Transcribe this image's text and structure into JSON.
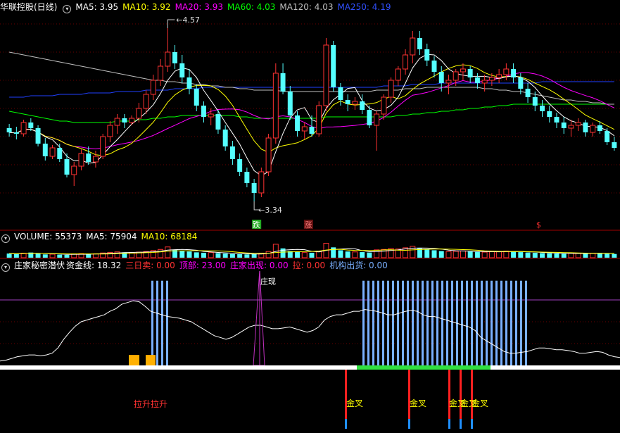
{
  "main_header": {
    "title": "华联控股(日线)",
    "ma5": "MA5: 3.95",
    "ma10": "MA10: 3.92",
    "ma20": "MA20: 3.93",
    "ma60": "MA60: 4.03",
    "ma120": "MA120: 4.03",
    "ma250": "MA250: 4.19"
  },
  "volume_header": {
    "label": "VOLUME: 55373",
    "ma5": "MA5: 75904",
    "ma10": "MA10: 68184"
  },
  "indicator_header": {
    "name": "庄家秘密潜伏",
    "fund_line": "资金线: 18.32",
    "three_day_sell": "三日卖: 0.00",
    "top": "顶部: 23.00",
    "dealer_appear": "庄家出现: 0.00",
    "pull": "拉: 0.00",
    "institution_ship": "机构出货: 0.00"
  },
  "colors": {
    "up": "#ff3232",
    "down": "#54ffff",
    "ma5": "#ffffff",
    "ma10": "#ffff00",
    "ma20": "#ff00ff",
    "ma60": "#00ff00",
    "ma120": "#c0c0c0",
    "ma250": "#2040ff",
    "bars": "#7ab0ff",
    "fund_line": "#ffffff",
    "purple": "#c040ff"
  },
  "chart_data": [
    {
      "type": "candlestick",
      "title": "华联控股(日线)",
      "ylim": [
        3.2,
        4.66
      ],
      "high_label": "4.57",
      "low_label": "3.34",
      "marks": [
        "跌",
        "涨",
        "$"
      ],
      "ohlc": [
        [
          3.86,
          3.89,
          3.8,
          3.83
        ],
        [
          3.83,
          3.87,
          3.78,
          3.82
        ],
        [
          3.82,
          3.92,
          3.8,
          3.9
        ],
        [
          3.9,
          3.93,
          3.84,
          3.86
        ],
        [
          3.86,
          3.88,
          3.73,
          3.75
        ],
        [
          3.75,
          3.79,
          3.63,
          3.66
        ],
        [
          3.66,
          3.74,
          3.64,
          3.72
        ],
        [
          3.72,
          3.75,
          3.62,
          3.64
        ],
        [
          3.64,
          3.68,
          3.51,
          3.53
        ],
        [
          3.53,
          3.62,
          3.45,
          3.59
        ],
        [
          3.59,
          3.71,
          3.56,
          3.68
        ],
        [
          3.68,
          3.73,
          3.6,
          3.62
        ],
        [
          3.62,
          3.7,
          3.58,
          3.66
        ],
        [
          3.66,
          3.82,
          3.64,
          3.8
        ],
        [
          3.8,
          3.91,
          3.76,
          3.88
        ],
        [
          3.88,
          3.96,
          3.82,
          3.93
        ],
        [
          3.93,
          3.96,
          3.86,
          3.9
        ],
        [
          3.9,
          3.95,
          3.88,
          3.93
        ],
        [
          3.93,
          4.04,
          3.9,
          4.0
        ],
        [
          4.0,
          4.13,
          3.96,
          4.1
        ],
        [
          4.1,
          4.24,
          4.06,
          4.2
        ],
        [
          4.2,
          4.35,
          4.16,
          4.3
        ],
        [
          4.3,
          4.57,
          4.26,
          4.4
        ],
        [
          4.4,
          4.45,
          4.28,
          4.32
        ],
        [
          4.32,
          4.38,
          4.18,
          4.22
        ],
        [
          4.22,
          4.28,
          4.1,
          4.14
        ],
        [
          4.14,
          4.17,
          3.98,
          4.02
        ],
        [
          4.02,
          4.05,
          3.9,
          3.94
        ],
        [
          3.94,
          4.0,
          3.88,
          3.96
        ],
        [
          3.96,
          3.99,
          3.82,
          3.85
        ],
        [
          3.85,
          3.88,
          3.7,
          3.73
        ],
        [
          3.73,
          3.77,
          3.6,
          3.64
        ],
        [
          3.64,
          3.68,
          3.52,
          3.55
        ],
        [
          3.55,
          3.58,
          3.44,
          3.47
        ],
        [
          3.47,
          3.5,
          3.34,
          3.4
        ],
        [
          3.4,
          3.58,
          3.37,
          3.55
        ],
        [
          3.55,
          3.82,
          3.52,
          3.79
        ],
        [
          3.79,
          4.32,
          3.75,
          4.25
        ],
        [
          4.25,
          4.32,
          4.1,
          4.12
        ],
        [
          4.12,
          4.16,
          3.92,
          3.95
        ],
        [
          3.95,
          3.98,
          3.8,
          3.84
        ],
        [
          3.84,
          3.9,
          3.78,
          3.87
        ],
        [
          3.87,
          3.95,
          3.8,
          3.82
        ],
        [
          3.82,
          4.05,
          3.8,
          4.02
        ],
        [
          4.02,
          4.5,
          3.98,
          4.45
        ],
        [
          4.45,
          4.48,
          4.12,
          4.15
        ],
        [
          4.15,
          4.18,
          4.02,
          4.06
        ],
        [
          4.06,
          4.1,
          3.98,
          4.03
        ],
        [
          4.03,
          4.08,
          3.99,
          4.05
        ],
        [
          4.05,
          4.1,
          3.96,
          3.99
        ],
        [
          3.99,
          4.02,
          3.86,
          3.88
        ],
        [
          3.88,
          3.98,
          3.7,
          3.96
        ],
        [
          3.96,
          4.1,
          3.92,
          4.08
        ],
        [
          4.08,
          4.22,
          4.04,
          4.2
        ],
        [
          4.2,
          4.3,
          4.16,
          4.28
        ],
        [
          4.28,
          4.42,
          4.24,
          4.38
        ],
        [
          4.38,
          4.55,
          4.32,
          4.5
        ],
        [
          4.5,
          4.55,
          4.38,
          4.42
        ],
        [
          4.42,
          4.46,
          4.3,
          4.34
        ],
        [
          4.34,
          4.37,
          4.22,
          4.26
        ],
        [
          4.26,
          4.3,
          4.12,
          4.18
        ],
        [
          4.18,
          4.24,
          4.1,
          4.2
        ],
        [
          4.2,
          4.28,
          4.16,
          4.26
        ],
        [
          4.26,
          4.32,
          4.2,
          4.28
        ],
        [
          4.28,
          4.3,
          4.18,
          4.22
        ],
        [
          4.22,
          4.25,
          4.14,
          4.18
        ],
        [
          4.18,
          4.24,
          4.12,
          4.2
        ],
        [
          4.2,
          4.25,
          4.16,
          4.22
        ],
        [
          4.22,
          4.28,
          4.18,
          4.24
        ],
        [
          4.24,
          4.32,
          4.2,
          4.28
        ],
        [
          4.28,
          4.32,
          4.18,
          4.22
        ],
        [
          4.22,
          4.25,
          4.1,
          4.14
        ],
        [
          4.14,
          4.18,
          4.04,
          4.08
        ],
        [
          4.08,
          4.12,
          3.98,
          4.02
        ],
        [
          4.02,
          4.06,
          3.94,
          3.98
        ],
        [
          3.98,
          4.02,
          3.9,
          3.94
        ],
        [
          3.94,
          3.97,
          3.86,
          3.9
        ],
        [
          3.9,
          3.94,
          3.82,
          3.86
        ],
        [
          3.86,
          3.92,
          3.8,
          3.88
        ],
        [
          3.88,
          3.93,
          3.84,
          3.9
        ],
        [
          3.9,
          3.92,
          3.8,
          3.83
        ],
        [
          3.83,
          3.9,
          3.8,
          3.88
        ],
        [
          3.88,
          3.91,
          3.82,
          3.84
        ],
        [
          3.84,
          3.86,
          3.74,
          3.76
        ],
        [
          3.76,
          3.8,
          3.7,
          3.72
        ]
      ],
      "ma_series": [
        {
          "name": "MA60",
          "values": [
            3.98,
            3.97,
            3.96,
            3.95,
            3.94,
            3.93,
            3.92,
            3.91,
            3.91,
            3.9,
            3.9,
            3.9,
            3.9,
            3.9,
            3.9,
            3.91,
            3.91,
            3.91,
            3.92,
            3.92,
            3.93,
            3.93,
            3.94,
            3.94,
            3.95,
            3.95,
            3.95,
            3.95,
            3.95,
            3.95,
            3.95,
            3.95,
            3.94,
            3.94,
            3.93,
            3.93,
            3.93,
            3.93,
            3.93,
            3.93,
            3.93,
            3.93,
            3.93,
            3.93,
            3.94,
            3.94,
            3.94,
            3.94,
            3.94,
            3.94,
            3.94,
            3.94,
            3.94,
            3.94,
            3.95,
            3.95,
            3.96,
            3.96,
            3.97,
            3.97,
            3.98,
            3.98,
            3.99,
            3.99,
            4.0,
            4.0,
            4.01,
            4.01,
            4.02,
            4.02,
            4.03,
            4.03,
            4.03,
            4.03,
            4.03,
            4.03,
            4.03,
            4.03,
            4.03,
            4.03,
            4.03,
            4.03,
            4.03,
            4.03,
            4.03
          ]
        },
        {
          "name": "MA250",
          "values": [
            4.08,
            4.08,
            4.08,
            4.09,
            4.09,
            4.09,
            4.09,
            4.1,
            4.1,
            4.1,
            4.1,
            4.11,
            4.11,
            4.11,
            4.11,
            4.12,
            4.12,
            4.12,
            4.12,
            4.13,
            4.13,
            4.13,
            4.13,
            4.14,
            4.14,
            4.14,
            4.14,
            4.15,
            4.15,
            4.15,
            4.15,
            4.15,
            4.15,
            4.15,
            4.15,
            4.15,
            4.15,
            4.15,
            4.15,
            4.15,
            4.15,
            4.15,
            4.15,
            4.15,
            4.15,
            4.15,
            4.15,
            4.15,
            4.15,
            4.15,
            4.15,
            4.15,
            4.16,
            4.16,
            4.16,
            4.16,
            4.17,
            4.17,
            4.17,
            4.17,
            4.18,
            4.18,
            4.18,
            4.18,
            4.18,
            4.18,
            4.18,
            4.18,
            4.18,
            4.18,
            4.18,
            4.18,
            4.18,
            4.18,
            4.19,
            4.19,
            4.19,
            4.19,
            4.19,
            4.19,
            4.19,
            4.19,
            4.19,
            4.19,
            4.19
          ]
        },
        {
          "name": "MA120",
          "values": [
            4.4,
            4.39,
            4.38,
            4.37,
            4.36,
            4.35,
            4.34,
            4.33,
            4.32,
            4.31,
            4.3,
            4.29,
            4.28,
            4.27,
            4.26,
            4.25,
            4.24,
            4.23,
            4.22,
            4.21,
            4.2,
            4.2,
            4.19,
            4.19,
            4.18,
            4.18,
            4.17,
            4.17,
            4.16,
            4.16,
            4.15,
            4.15,
            4.14,
            4.14,
            4.13,
            4.13,
            4.13,
            4.13,
            4.12,
            4.12,
            4.12,
            4.12,
            4.12,
            4.12,
            4.12,
            4.12,
            4.12,
            4.12,
            4.12,
            4.12,
            4.12,
            4.13,
            4.13,
            4.13,
            4.13,
            4.14,
            4.14,
            4.14,
            4.15,
            4.15,
            4.15,
            4.15,
            4.15,
            4.15,
            4.15,
            4.15,
            4.14,
            4.14,
            4.13,
            4.13,
            4.12,
            4.12,
            4.11,
            4.1,
            4.09,
            4.08,
            4.07,
            4.06,
            4.06,
            4.05,
            4.05,
            4.04,
            4.04,
            4.03,
            4.03
          ]
        }
      ]
    },
    {
      "type": "bar",
      "title": "VOLUME",
      "values": [
        20,
        18,
        22,
        25,
        19,
        16,
        17,
        15,
        14,
        18,
        20,
        17,
        19,
        23,
        26,
        28,
        26,
        25,
        27,
        30,
        35,
        40,
        52,
        38,
        34,
        30,
        26,
        24,
        25,
        22,
        20,
        18,
        17,
        16,
        18,
        22,
        30,
        65,
        45,
        32,
        28,
        25,
        24,
        30,
        70,
        50,
        36,
        30,
        28,
        27,
        25,
        38,
        40,
        45,
        42,
        48,
        55,
        46,
        40,
        36,
        32,
        30,
        31,
        33,
        30,
        28,
        27,
        29,
        30,
        32,
        30,
        27,
        25,
        24,
        22,
        21,
        20,
        19,
        22,
        21,
        20,
        22,
        21,
        19,
        18
      ]
    },
    {
      "type": "area",
      "title": "庄家秘密潜伏",
      "fund_line": [
        5,
        6,
        8,
        10,
        11,
        12,
        12,
        11,
        12,
        14,
        20,
        30,
        38,
        45,
        50,
        52,
        54,
        56,
        58,
        62,
        65,
        70,
        72,
        74,
        73,
        68,
        62,
        60,
        58,
        56,
        55,
        54,
        52,
        50,
        46,
        42,
        38,
        34,
        32,
        30,
        32,
        36,
        40,
        44,
        46,
        46,
        44,
        42,
        42,
        43,
        44,
        42,
        40,
        38,
        40,
        44,
        52,
        56,
        58,
        58,
        60,
        62,
        62,
        64,
        63,
        62,
        60,
        58,
        58,
        60,
        62,
        63,
        62,
        58,
        56,
        56,
        54,
        52,
        50,
        48,
        46,
        44,
        40,
        32,
        28,
        24,
        20,
        16,
        14,
        14,
        15,
        16,
        18,
        20,
        20,
        19,
        18,
        18,
        17,
        16,
        14,
        14,
        15,
        16,
        15,
        12,
        10,
        9
      ],
      "reference_line": 75,
      "dealer_peak_label": "庄现",
      "orange_blocks": 2,
      "labels": [
        "拉升拉升",
        "金叉",
        "金叉",
        "金叉",
        "金叉",
        "金叉"
      ]
    }
  ]
}
